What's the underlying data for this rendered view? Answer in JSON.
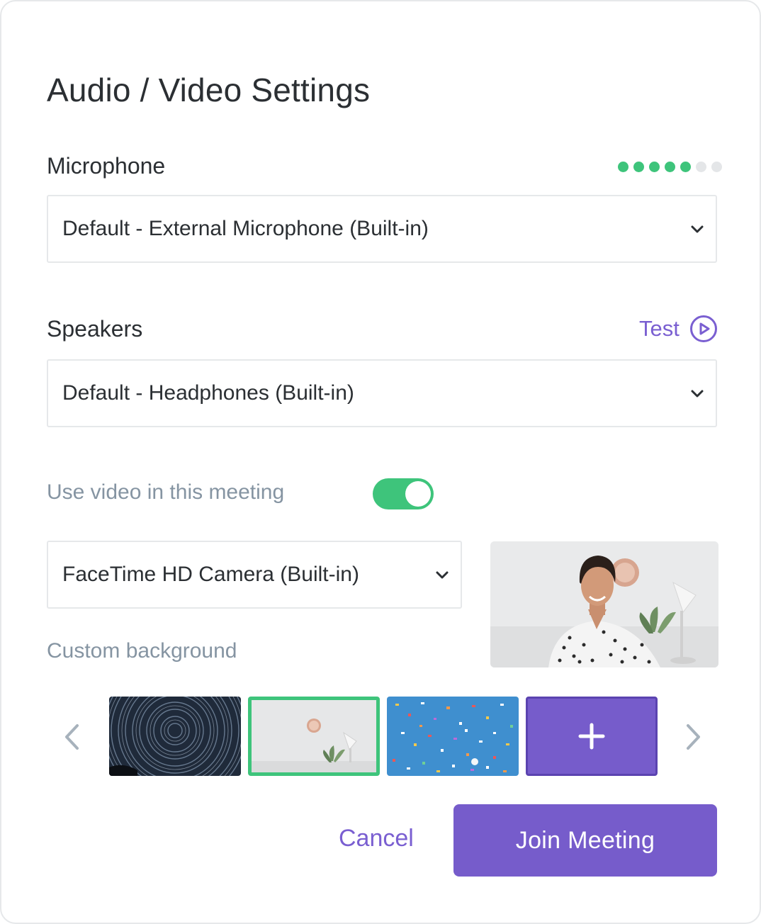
{
  "dialog": {
    "title": "Audio / Video Settings"
  },
  "microphone": {
    "label": "Microphone",
    "selected": "Default - External Microphone (Built-in)",
    "level": {
      "active": 5,
      "total": 7
    }
  },
  "speakers": {
    "label": "Speakers",
    "selected": "Default - Headphones (Built-in)",
    "test_label": "Test"
  },
  "video": {
    "toggle_label": "Use video in this meeting",
    "enabled": true,
    "camera_selected": "FaceTime HD Camera (Built-in)"
  },
  "background": {
    "label": "Custom background",
    "thumbnails": [
      {
        "name": "star-trails",
        "selected": false
      },
      {
        "name": "wall-clock-room",
        "selected": true
      },
      {
        "name": "confetti-blue-sky",
        "selected": false
      }
    ],
    "add_symbol": "+"
  },
  "actions": {
    "cancel_label": "Cancel",
    "join_label": "Join Meeting"
  },
  "colors": {
    "accent": "#765ccb",
    "success": "#3ec47b",
    "muted_text": "#8594a2"
  }
}
